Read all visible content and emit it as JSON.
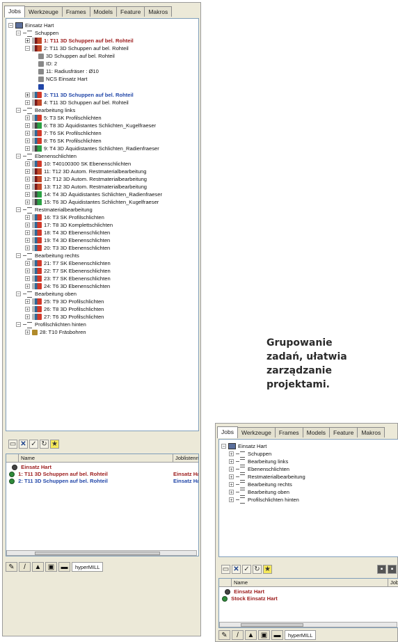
{
  "tabs": [
    "Jobs",
    "Werkzeuge",
    "Frames",
    "Models",
    "Feature",
    "Makros"
  ],
  "main_tree": {
    "root": "Einsatz Hart",
    "groups": [
      {
        "label": "Schuppen"
      },
      {
        "label": "Bearbeitung links"
      },
      {
        "label": "Ebenenschlichten"
      },
      {
        "label": "Restmaterialbearbeitung"
      },
      {
        "label": "Bearbeitung rechts"
      },
      {
        "label": "Bearbeitung oben"
      },
      {
        "label": "Profilschlichten hinten"
      }
    ],
    "jobs": [
      "1: T11 3D Schuppen auf bel. Rohteil",
      "2: T11 3D Schuppen auf bel. Rohteil",
      "3: T11 3D Schuppen auf bel. Rohteil",
      "4: T11 3D Schuppen auf bel. Rohteil",
      "5: T3 SK Profilschlichten",
      "6: T8 3D Äquidistantes Schlichten_Kugelfraeser",
      "7: T6 SK Profilschlichten",
      "8: T6 SK Profilschlichten",
      "9: T4 3D Äquidistantes Schlichten_Radienfraeser",
      "10: T40100300 SK Ebenenschlichten",
      "11: T12 3D Autom. Restmaterialbearbeitung",
      "12: T12 3D Autom. Restmaterialbearbeitung",
      "13: T12 3D Autom. Restmaterialbearbeitung",
      "14: T4 3D Äquidistantes Schlichten_Radienfraeser",
      "15: T6 3D Äquidistantes Schlichten_Kugelfraeser",
      "16: T3 SK Profilschlichten",
      "17: T8 3D Komplettschlichten",
      "18: T4 3D Ebenenschlichten",
      "19: T4 3D Ebenenschlichten",
      "20: T3 3D Ebenenschlichten",
      "21: T7 SK Ebenenschlichten",
      "22: T7 SK Ebenenschlichten",
      "23: T7 SK Ebenenschlichten",
      "24: T6 3D Ebenenschlichten",
      "25: T9 3D Profilschlichten",
      "26: T8 3D Profilschlichten",
      "27: T6 3D Profilschlichten",
      "28: T10 Fräsbohren"
    ],
    "details": {
      "cad": "3D Schuppen auf bel. Rohteil",
      "id": "ID: 2",
      "tool": "11: Radiusfräser : Ø10",
      "ncs": "NCS Einsatz Hart"
    }
  },
  "main_list": {
    "columns": [
      "Name",
      "Joblistenname"
    ],
    "rows": [
      {
        "name": "Einsatz Hart",
        "list": ""
      },
      {
        "name": "1: T11 3D Schuppen auf bel. Rohteil",
        "list": "Einsatz Hart"
      },
      {
        "name": "2: T11 3D Schuppen auf bel. Rohteil",
        "list": "Einsatz Hart"
      }
    ]
  },
  "bottom_tab": "hyperMILL",
  "caption": [
    "Grupowanie",
    "zadań, ułatwia",
    "zarządzanie",
    "projektami."
  ],
  "small_tree": {
    "root": "Einsatz Hart",
    "groups": [
      "Schuppen",
      "Bearbeitung links",
      "Ebenenschlichten",
      "Restmaterialbearbeitung",
      "Bearbeitung rechts",
      "Bearbeitung oben",
      "Profilschlichten hinten"
    ]
  },
  "small_list": {
    "columns": [
      "Name",
      "Job"
    ],
    "rows": [
      "Einsatz Hart",
      "Stock Einsatz Hart"
    ]
  },
  "colors": {
    "accent_red": "#9b1a1a",
    "accent_blue": "#2146a8",
    "panel": "#ece9d8"
  }
}
